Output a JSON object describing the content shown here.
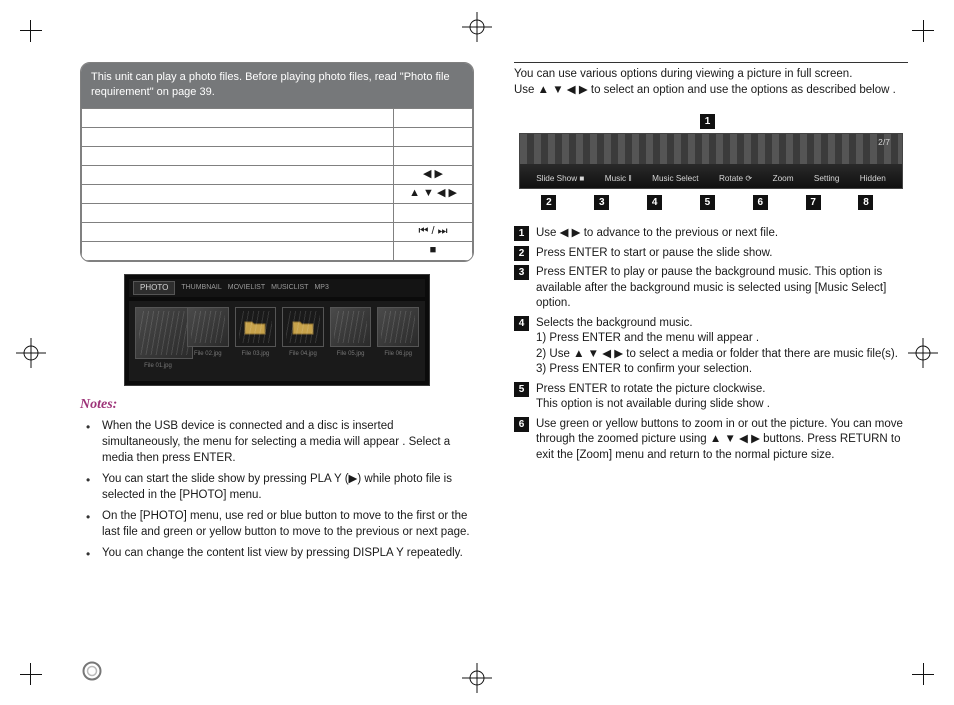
{
  "left": {
    "box_head": "This unit can play a photo files. Before playing photo files, read \"Photo file requirement\" on page 39.",
    "table": {
      "row1l": "",
      "row1r": "",
      "row2l": "",
      "row2r": "",
      "row3l": "",
      "row3r": "",
      "row4l": "",
      "row4r": "◀ ▶",
      "row5l": "",
      "row5r": "▲ ▼ ◀ ▶",
      "row6l": "",
      "row6r": "",
      "row7l": "",
      "row7r": "⏮ / ⏭",
      "row8l": "",
      "row8r": "■"
    },
    "photo_tab": "PHOTO",
    "photo_sub1": "THUMBNAIL",
    "photo_sub2": "MOVIELIST",
    "photo_sub3": "MUSICLIST",
    "photo_sub4": "MP3",
    "thumb_caps": {
      "a": "File 01.jpg",
      "b": "File 02.jpg",
      "c": "File 03.jpg",
      "d": "File 04.jpg",
      "e": "File 05.jpg",
      "f": "File 06.jpg"
    },
    "notes_head": "Notes:",
    "notes": {
      "n1": "When the USB device is connected and a disc is inserted simultaneously, the menu for selecting a media will appear . Select a media then press ENTER.",
      "n2": "You can start the slide show by pressing PLA Y (▶) while photo file is selected in the [PHOTO] menu.",
      "n3": "On the [PHOTO] menu, use red or blue button to move to the first or the last file and green or yellow button to move to the previous or next page.",
      "n4": "You can change the content list view by pressing DISPLA Y repeatedly."
    }
  },
  "right": {
    "intro1": "You can use various options during viewing a picture in full screen.",
    "intro2": "Use ▲ ▼ ◀ ▶ to select an option and use the options as described below .",
    "osd_page": "2/7",
    "osd": {
      "i1": "Slide Show ■",
      "i2": "Music ‖",
      "i3": "Music Select",
      "i4": "Rotate ⟳",
      "i5": "Zoom",
      "i6": "Setting",
      "i7": "Hidden"
    },
    "labels": {
      "n1": "1",
      "n2": "2",
      "n3": "3",
      "n4": "4",
      "n5": "5",
      "n6": "6",
      "n7": "7",
      "n8": "8"
    },
    "list": {
      "l1": "Use ◀ ▶ to advance to the previous or next file.",
      "l2": "Press ENTER to start or pause the slide show.",
      "l3a": "Press ENTER to play or pause the background music.  This option is available after the background music is selected using [Music Select] option.",
      "l4a": "Selects the background music.",
      "l4b": "1)  Press ENTER and the menu will appear .",
      "l4c": "2) Use  ▲ ▼ ◀ ▶ to select a media or folder that there are music file(s).",
      "l4d": "3)  Press ENTER to confirm your selection.",
      "l5a": "Press ENTER to rotate the picture clockwise.",
      "l5b": "This option is not available during slide show .",
      "l6": "Use green or yellow buttons to zoom in or out the picture.  You can move through the zoomed picture using ▲ ▼ ◀ ▶ buttons. Press RETURN to exit the [Zoom] menu and return to the normal picture size."
    }
  }
}
